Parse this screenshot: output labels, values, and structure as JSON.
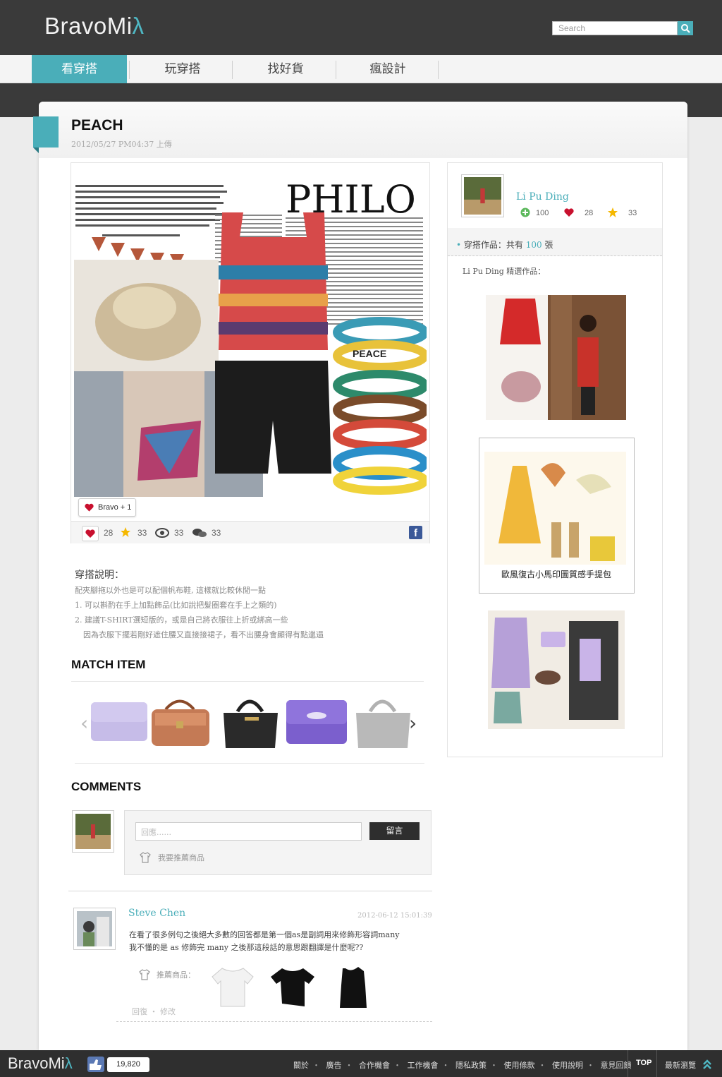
{
  "header": {
    "logo": "BravoMi",
    "logo_accent": "λ",
    "search_placeholder": "Search"
  },
  "nav": {
    "tabs": [
      {
        "label": "看穿搭",
        "active": true
      },
      {
        "label": "玩穿搭",
        "active": false
      },
      {
        "label": "找好貨",
        "active": false
      },
      {
        "label": "瘋設計",
        "active": false
      }
    ]
  },
  "post": {
    "title": "PEACH",
    "date": "2012/05/27 PM04:37 上傳",
    "collage_text": "PHILO",
    "collage_bracelet_text": "PEACE",
    "bravo_label": "Bravo + 1",
    "stats": {
      "likes": "28",
      "stars": "33",
      "views": "33",
      "comments": "33"
    },
    "fb_label": "f"
  },
  "description": {
    "title": "穿搭說明：",
    "lines": [
      "配夾腳拖以外也是可以配個帆布鞋, 這樣就比較休閒一點",
      "1. 可以斟酌在手上加點飾品(比如說把髮圈套在手上之類的)",
      "2. 建議T-SHIRT選短版的，或是自己將衣服往上折或綁高一些",
      "因為衣服下擺若剛好遮住腰又直接接裙子，看不出腰身會顯得有點邋遢"
    ]
  },
  "match": {
    "title": "MATCH ITEM",
    "items": [
      "purple-clutch",
      "brown-satchel",
      "black-handbag",
      "purple-satchel",
      "grey-handbag"
    ]
  },
  "comments": {
    "title": "COMMENTS",
    "input_placeholder": "回應......",
    "submit_label": "留言",
    "recommend_label": "我要推薦商品",
    "list": [
      {
        "name": "Steve Chen",
        "time": "2012-06-12 15:01:39",
        "lines": [
          "在看了很多例句之後絕大多數的回答都是第一個as是副詞用來修飾形容詞many",
          "我不懂的是 as 修飾完 many 之後那這段話的意思跟翻譯是什麼呢??"
        ],
        "rec_label": "推薦商品：",
        "reply_label": "回復",
        "edit_label": "修改"
      }
    ]
  },
  "sidebar": {
    "name": "Li Pu Ding",
    "stats": {
      "follow": "100",
      "likes": "28",
      "stars": "33"
    },
    "works_prefix": "穿搭作品：共有",
    "works_count": "100",
    "works_suffix": "張",
    "selected_label": "Li Pu Ding 精選作品：",
    "thumb_caption": "歐風復古小馬印圖質感手提包"
  },
  "footer": {
    "logo": "BravoMi",
    "logo_accent": "λ",
    "like_count": "19,820",
    "links": [
      "關於",
      "廣告",
      "合作機會",
      "工作機會",
      "隱私政策",
      "使用條款",
      "使用說明",
      "意見回饋"
    ],
    "top_label": "TOP",
    "latest_label": "最新瀏覽"
  },
  "colors": {
    "accent": "#4aaeb9",
    "dark": "#3a3a3a",
    "heart": "#c8102e",
    "star": "#f5b800"
  }
}
